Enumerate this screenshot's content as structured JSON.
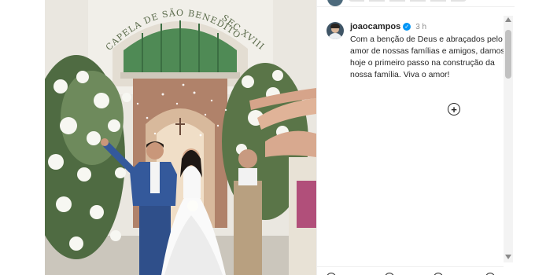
{
  "post": {
    "photo": {
      "facade_lines": [
        "CAPELA DE SÃO BENEDITO",
        "SEC XVIII"
      ]
    },
    "caption": {
      "username": "joaocampos",
      "verified_icon": "verified-badge-icon",
      "time": "3 h",
      "text": "Com a benção de Deus e abraçados pelo amor de nossas famílias e amigos, damos hoje o primeiro passo na construção da nossa família. Viva o amor!"
    },
    "icons": {
      "add_comment": "add-circle-icon",
      "scroll_up": "scroll-up-arrow-icon",
      "scroll_down": "scroll-down-arrow-icon"
    },
    "colors": {
      "verified": "#0095f6",
      "text": "#262626",
      "muted": "#8e8e8e",
      "door": "#4f8a55"
    }
  }
}
